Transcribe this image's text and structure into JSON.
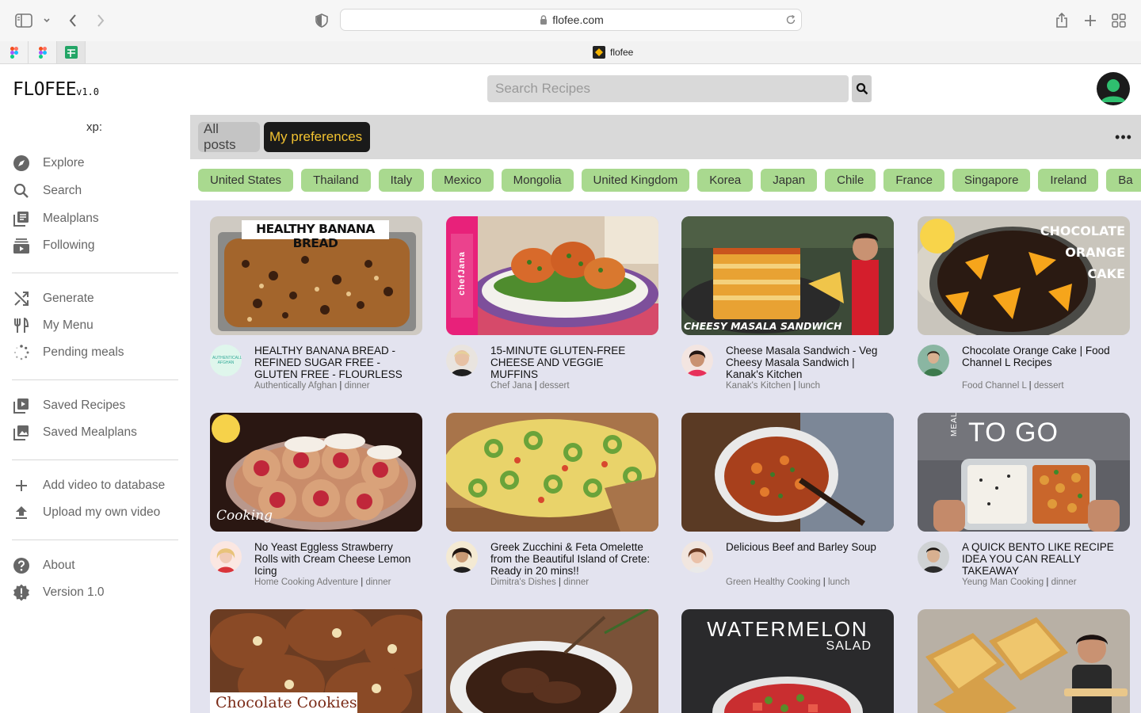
{
  "browser": {
    "url": "flofee.com",
    "tab_title": "flofee"
  },
  "app": {
    "title": "FLOFEE",
    "version_tag": "v1.0",
    "search_placeholder": "Search Recipes",
    "xp_label": "xp:"
  },
  "sidebar": {
    "group1": [
      {
        "label": "Explore",
        "icon": "compass-icon"
      },
      {
        "label": "Search",
        "icon": "search-icon"
      },
      {
        "label": "Mealplans",
        "icon": "library-icon"
      },
      {
        "label": "Following",
        "icon": "subscriptions-icon"
      }
    ],
    "group2": [
      {
        "label": "Generate",
        "icon": "shuffle-icon"
      },
      {
        "label": "My Menu",
        "icon": "cutlery-icon"
      },
      {
        "label": "Pending meals",
        "icon": "loading-dots-icon"
      }
    ],
    "group3": [
      {
        "label": "Saved Recipes",
        "icon": "video-library-icon"
      },
      {
        "label": "Saved Mealplans",
        "icon": "collections-icon"
      }
    ],
    "group4": [
      {
        "label": "Add video to database",
        "icon": "plus-icon"
      },
      {
        "label": "Upload my own video",
        "icon": "upload-icon"
      }
    ],
    "group5": [
      {
        "label": "About",
        "icon": "help-icon"
      },
      {
        "label": "Version 1.0",
        "icon": "badge-icon"
      }
    ]
  },
  "main": {
    "tabs": {
      "all": "All posts",
      "preferences": "My preferences"
    },
    "more_label": "•••",
    "countries": [
      "United States",
      "Thailand",
      "Italy",
      "Mexico",
      "Mongolia",
      "United Kingdom",
      "Korea",
      "Japan",
      "Chile",
      "France",
      "Singapore",
      "Ireland",
      "Ba"
    ],
    "recipes": [
      {
        "title": "HEALTHY BANANA BREAD - REFINED SUGAR FREE - GLUTEN FREE - FLOURLESS",
        "channel": "Authentically Afghan",
        "meal": "dinner",
        "thumb_text": "HEALTHY BANANA BREAD",
        "avatar_text": "AUTHENTICALLY AFGHAN"
      },
      {
        "title": "15-MINUTE GLUTEN-FREE CHEESE AND VEGGIE MUFFINS",
        "channel": "Chef Jana",
        "meal": "dessert",
        "thumb_text": "chefJana"
      },
      {
        "title": "Cheese Masala Sandwich - Veg Cheesy Masala Sandwich | Kanak's Kitchen",
        "channel": "Kanak's Kitchen",
        "meal": "lunch",
        "thumb_text": "CHEESY MASALA SANDWICH"
      },
      {
        "title": "Chocolate Orange Cake | Food Channel L Recipes",
        "channel": "Food Channel L",
        "meal": "dessert",
        "thumb_text": [
          "CHOCOLATE",
          "ORANGE",
          "CAKE"
        ]
      },
      {
        "title": "No Yeast Eggless Strawberry Rolls with Cream Cheese Lemon Icing",
        "channel": "Home Cooking Adventure",
        "meal": "dinner",
        "thumb_text": "Cooking"
      },
      {
        "title": "Greek Zucchini & Feta Omelette from the Beautiful Island of Crete: Ready in 20 mins!!",
        "channel": "Dimitra's Dishes",
        "meal": "dinner"
      },
      {
        "title": "Delicious Beef and Barley Soup",
        "channel": "Green Healthy Cooking",
        "meal": "lunch"
      },
      {
        "title": "A QUICK BENTO LIKE RECIPE IDEA YOU CAN REALLY TAKEAWAY",
        "channel": "Yeung Man Cooking",
        "meal": "dinner",
        "thumb_text": [
          "MEAL",
          "TO GO"
        ]
      },
      {
        "title": "",
        "channel": "",
        "meal": "",
        "thumb_text": "Chocolate Cookies"
      },
      {
        "title": "",
        "channel": "",
        "meal": ""
      },
      {
        "title": "",
        "channel": "",
        "meal": "",
        "thumb_text": [
          "WATERMELON",
          "SALAD"
        ]
      },
      {
        "title": "",
        "channel": "",
        "meal": ""
      }
    ]
  },
  "colors": {
    "chip_green": "#a9d98f",
    "pref_text": "#f2c230",
    "main_bg": "#e3e3ef"
  }
}
